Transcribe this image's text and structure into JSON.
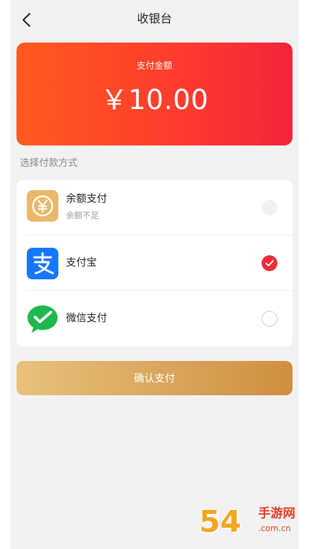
{
  "header": {
    "title": "收银台"
  },
  "amount": {
    "label": "支付金额",
    "value": "￥10.00"
  },
  "section": {
    "label": "选择付款方式"
  },
  "methods": [
    {
      "name": "余额支付",
      "sub": "余额不足",
      "state": "disabled",
      "icon": "balance-yen-icon"
    },
    {
      "name": "支付宝",
      "sub": "",
      "state": "checked",
      "icon": "alipay-icon"
    },
    {
      "name": "微信支付",
      "sub": "",
      "state": "unchecked",
      "icon": "wechat-pay-icon"
    }
  ],
  "confirm": {
    "label": "确认支付"
  },
  "watermark": {
    "big": "54",
    "cn": "手游网",
    "domain": ".com.cn"
  },
  "colors": {
    "accent": "#ef2b3d",
    "card_start": "#ff5a1f",
    "card_end": "#f2243a",
    "button": "#d9a55d"
  }
}
